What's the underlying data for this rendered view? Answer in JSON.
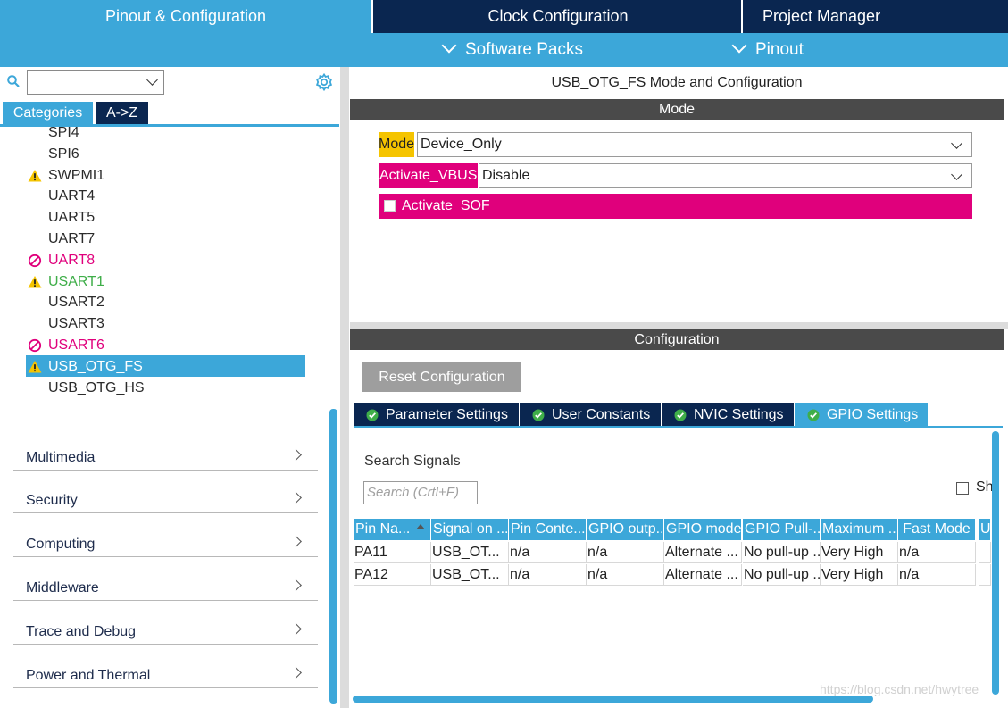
{
  "top_tabs": [
    "Pinout & Configuration",
    "Clock Configuration",
    "Project Manager"
  ],
  "sub_menu": [
    "Software Packs",
    "Pinout"
  ],
  "left": {
    "category_tabs": [
      "Categories",
      "A->Z"
    ],
    "tree_items": [
      {
        "label": "SPI4",
        "status": "none",
        "color": "#2b2b2b"
      },
      {
        "label": "SPI6",
        "status": "none",
        "color": "#2b2b2b"
      },
      {
        "label": "SWPMI1",
        "status": "warning-icon",
        "color": "#2b2b2b"
      },
      {
        "label": "UART4",
        "status": "none",
        "color": "#2b2b2b"
      },
      {
        "label": "UART5",
        "status": "none",
        "color": "#2b2b2b"
      },
      {
        "label": "UART7",
        "status": "none",
        "color": "#2b2b2b"
      },
      {
        "label": "UART8",
        "status": "blocked-icon",
        "color": "#e0007c"
      },
      {
        "label": "USART1",
        "status": "warning-icon",
        "color": "#3fae49"
      },
      {
        "label": "USART2",
        "status": "none",
        "color": "#2b2b2b"
      },
      {
        "label": "USART3",
        "status": "none",
        "color": "#2b2b2b"
      },
      {
        "label": "USART6",
        "status": "blocked-icon",
        "color": "#e0007c"
      },
      {
        "label": "USB_OTG_FS",
        "status": "warning-icon",
        "color": "#ffffff",
        "selected": true
      },
      {
        "label": "USB_OTG_HS",
        "status": "none",
        "color": "#2b2b2b"
      }
    ],
    "groups": [
      "Multimedia",
      "Security",
      "Computing",
      "Middleware",
      "Trace and Debug",
      "Power and Thermal"
    ]
  },
  "mode_panel": {
    "title": "USB_OTG_FS Mode and Configuration",
    "section": "Mode",
    "mode_label": "Mode",
    "mode_value": "Device_Only",
    "vbus_label": "Activate_VBUS",
    "vbus_value": "Disable",
    "sof_label": "Activate_SOF"
  },
  "config_panel": {
    "section": "Configuration",
    "reset_button": "Reset Configuration",
    "tabs": [
      "Parameter Settings",
      "User Constants",
      "NVIC Settings",
      "GPIO Settings"
    ],
    "search_label": "Search Signals",
    "search_placeholder": "Search (Crtl+F)",
    "show_label": "Sh",
    "columns": [
      "Pin Na...",
      "Signal on ...",
      "Pin Conte...",
      "GPIO outp...",
      "GPIO mode",
      "GPIO Pull-...",
      "Maximum ...",
      "Fast Mode",
      "U"
    ],
    "rows": [
      [
        "PA11",
        "USB_OT...",
        "n/a",
        "n/a",
        "Alternate ...",
        "No pull-up ...",
        "Very High",
        "n/a",
        ""
      ],
      [
        "PA12",
        "USB_OT...",
        "n/a",
        "n/a",
        "Alternate ...",
        "No pull-up ...",
        "Very High",
        "n/a",
        ""
      ]
    ]
  },
  "watermark": "https://blog.csdn.net/hwytree",
  "colors": {
    "accent": "#3ca7d9",
    "navy": "#0a2650",
    "magenta": "#e0007c",
    "yellow": "#f5c400",
    "section_gray": "#4a4a4a"
  }
}
